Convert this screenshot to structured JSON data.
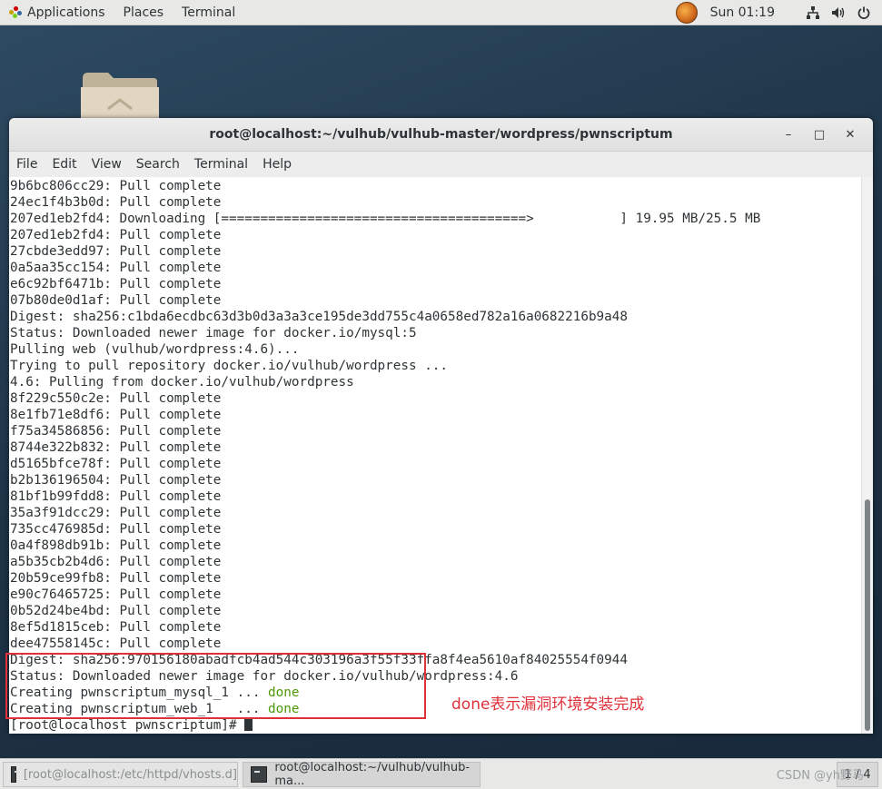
{
  "top_panel": {
    "applications": "Applications",
    "places": "Places",
    "terminal": "Terminal",
    "clock": "Sun 01:19"
  },
  "icons": {
    "network": "network-icon",
    "volume": "volume-icon",
    "power": "power-icon"
  },
  "window": {
    "title": "root@localhost:~/vulhub/vulhub-master/wordpress/pwnscriptum",
    "minimize": "–",
    "maximize": "□",
    "close": "✕"
  },
  "menu": [
    "File",
    "Edit",
    "View",
    "Search",
    "Terminal",
    "Help"
  ],
  "terminal_lines": [
    "9b6bc806cc29: Pull complete",
    "24ec1f4b3b0d: Pull complete",
    "207ed1eb2fd4: Downloading [=======================================>           ] 19.95 MB/25.5 MB",
    "207ed1eb2fd4: Pull complete",
    "27cbde3edd97: Pull complete",
    "0a5aa35cc154: Pull complete",
    "e6c92bf6471b: Pull complete",
    "07b80de0d1af: Pull complete",
    "Digest: sha256:c1bda6ecdbc63d3b0d3a3a3ce195de3dd755c4a0658ed782a16a0682216b9a48",
    "Status: Downloaded newer image for docker.io/mysql:5",
    "Pulling web (vulhub/wordpress:4.6)...",
    "Trying to pull repository docker.io/vulhub/wordpress ...",
    "4.6: Pulling from docker.io/vulhub/wordpress",
    "8f229c550c2e: Pull complete",
    "8e1fb71e8df6: Pull complete",
    "f75a34586856: Pull complete",
    "8744e322b832: Pull complete",
    "d5165bfce78f: Pull complete",
    "b2b136196504: Pull complete",
    "81bf1b99fdd8: Pull complete",
    "35a3f91dcc29: Pull complete",
    "735cc476985d: Pull complete",
    "0a4f898db91b: Pull complete",
    "a5b35cb2b4d6: Pull complete",
    "20b59ce99fb8: Pull complete",
    "e90c76465725: Pull complete",
    "0b52d24be4bd: Pull complete",
    "8ef5d1815ceb: Pull complete",
    "dee47558145c: Pull complete",
    "Digest: sha256:970156180abadfcb4ad544c303196a3f55f33ffa8f4ea5610af84025554f0944",
    "Status: Downloaded newer image for docker.io/vulhub/wordpress:4.6"
  ],
  "creating_lines": [
    {
      "prefix": "Creating pwnscriptum_mysql_1 ... ",
      "status": "done"
    },
    {
      "prefix": "Creating pwnscriptum_web_1   ... ",
      "status": "done"
    }
  ],
  "prompt": "[root@localhost pwnscriptum]# ",
  "annotation": "done表示漏洞环境安装完成",
  "taskbar": {
    "task1": "[root@localhost:/etc/httpd/vhosts.d]",
    "task2": "root@localhost:~/vulhub/vulhub-ma...",
    "workspace": "1 / 4"
  },
  "watermark": "CSDN @yh野马"
}
